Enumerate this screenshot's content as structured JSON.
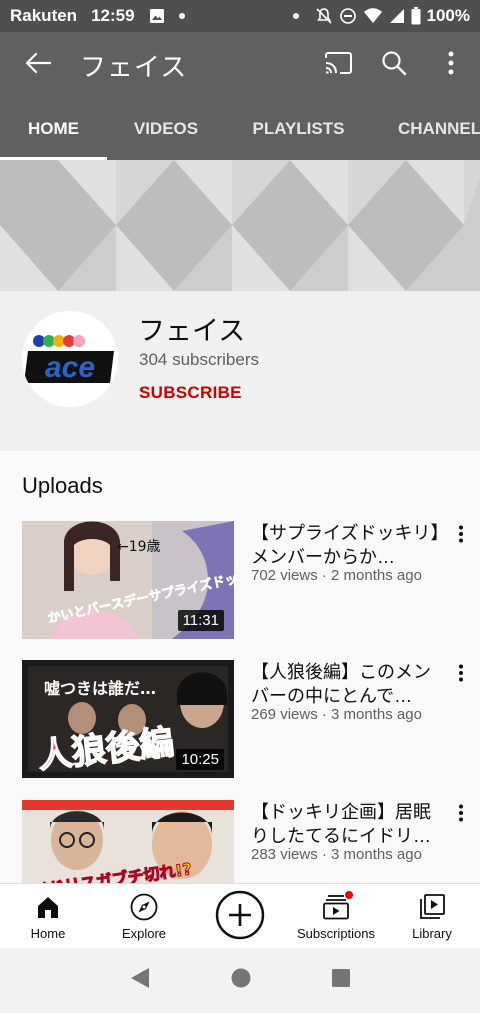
{
  "status_bar": {
    "carrier": "Rakuten",
    "time": "12:59",
    "battery": "100%"
  },
  "app_bar": {
    "title": "フェイス",
    "icons": [
      "back-arrow-icon",
      "cast-icon",
      "search-icon",
      "more-vert-icon"
    ]
  },
  "tabs": [
    {
      "label": "HOME",
      "active": true
    },
    {
      "label": "VIDEOS",
      "active": false
    },
    {
      "label": "PLAYLISTS",
      "active": false
    },
    {
      "label": "CHANNEL",
      "active": false
    }
  ],
  "channel": {
    "name": "フェイス",
    "subscribers": "304 subscribers",
    "subscribe_label": "SUBSCRIBE",
    "avatar_text": "ace"
  },
  "uploads": {
    "title": "Uploads",
    "videos": [
      {
        "title": "【サプライズドッキリ】メンバーからか…",
        "meta": "702 views · 2 months ago",
        "duration": "11:31",
        "thumb_text_top": "←19歳",
        "thumb_text_main": "かいとバースデーサプライズドッキリ"
      },
      {
        "title": "【人狼後編】このメンバーの中にとんで…",
        "meta": "269 views · 3 months ago",
        "duration": "10:25",
        "thumb_text_top": "嘘つきは誰だ…",
        "thumb_text_main": "人狼後編"
      },
      {
        "title": "【ドッキリ企画】居眠りしたてるにイドリ…",
        "meta": "283 views · 3 months ago",
        "duration": "",
        "thumb_text_top": "",
        "thumb_text_main": "イドリスガブチ切れ!?"
      }
    ]
  },
  "bottom_nav": [
    {
      "label": "Home",
      "icon": "home-icon"
    },
    {
      "label": "Explore",
      "icon": "compass-icon"
    },
    {
      "label": "",
      "icon": "add-circle-icon"
    },
    {
      "label": "Subscriptions",
      "icon": "subscriptions-icon"
    },
    {
      "label": "Library",
      "icon": "library-icon"
    }
  ],
  "colors": {
    "header_bg": "#606060",
    "status_bg": "#4f4f4f",
    "subscribe": "#cc0000"
  }
}
